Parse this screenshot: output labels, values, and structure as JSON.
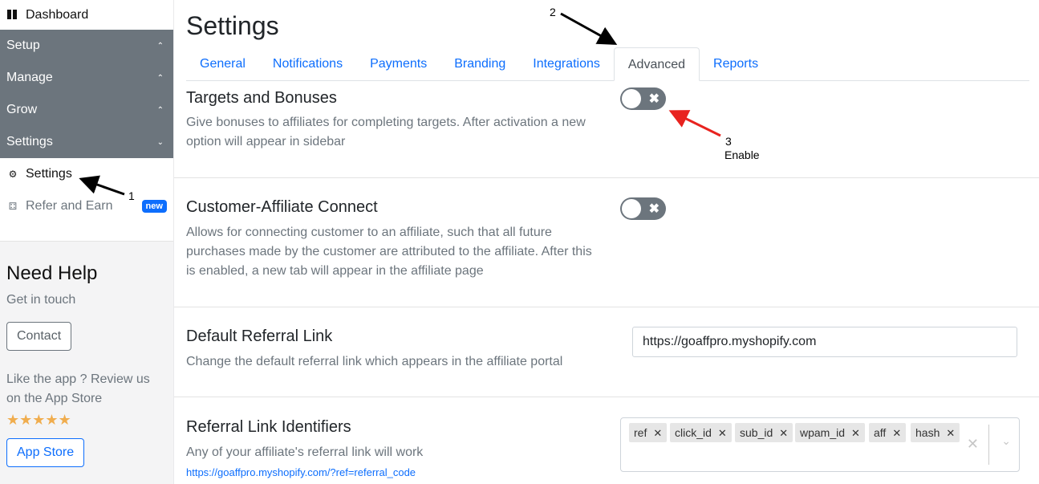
{
  "sidebar": {
    "dashboard": "Dashboard",
    "sections": [
      {
        "label": "Setup",
        "chevron": "⌃"
      },
      {
        "label": "Manage",
        "chevron": "⌃"
      },
      {
        "label": "Grow",
        "chevron": "⌃"
      },
      {
        "label": "Settings",
        "chevron": "⌄"
      }
    ],
    "settings_item": "Settings",
    "refer_item": "Refer and Earn",
    "new_badge": "new",
    "help": {
      "title": "Need Help",
      "subtitle": "Get in touch",
      "contact": "Contact",
      "review": "Like the app ? Review us on the App Store",
      "stars": "★★★★★",
      "app_store": "App Store"
    }
  },
  "main": {
    "title": "Settings",
    "tabs": [
      "General",
      "Notifications",
      "Payments",
      "Branding",
      "Integrations",
      "Advanced",
      "Reports"
    ],
    "active_tab": "Advanced",
    "targets": {
      "title": "Targets and Bonuses",
      "desc": "Give bonuses to affiliates for completing targets. After activation a new option will appear in sidebar",
      "enabled": false
    },
    "connect": {
      "title": "Customer-Affiliate Connect",
      "desc": "Allows for connecting customer to an affiliate, such that all future purchases made by the customer are attributed to the affiliate. After this is enabled, a new tab will appear in the affiliate page",
      "enabled": false
    },
    "default_link": {
      "title": "Default Referral Link",
      "desc": "Change the default referral link which appears in the affiliate portal",
      "value": "https://goaffpro.myshopify.com"
    },
    "identifiers": {
      "title": "Referral Link Identifiers",
      "desc": "Any of your affiliate's referral link will work",
      "example": "https://goaffpro.myshopify.com/?ref=referral_code",
      "tags": [
        "ref",
        "click_id",
        "sub_id",
        "wpam_id",
        "aff",
        "hash"
      ]
    }
  },
  "annotations": {
    "a1": "1",
    "a2": "2",
    "a3": "3",
    "a3_label": "Enable"
  },
  "colors": {
    "accent": "#0d6efd",
    "sidebar_section": "#6c757d",
    "arrow_black": "#000000",
    "arrow_red": "#e8231f"
  }
}
